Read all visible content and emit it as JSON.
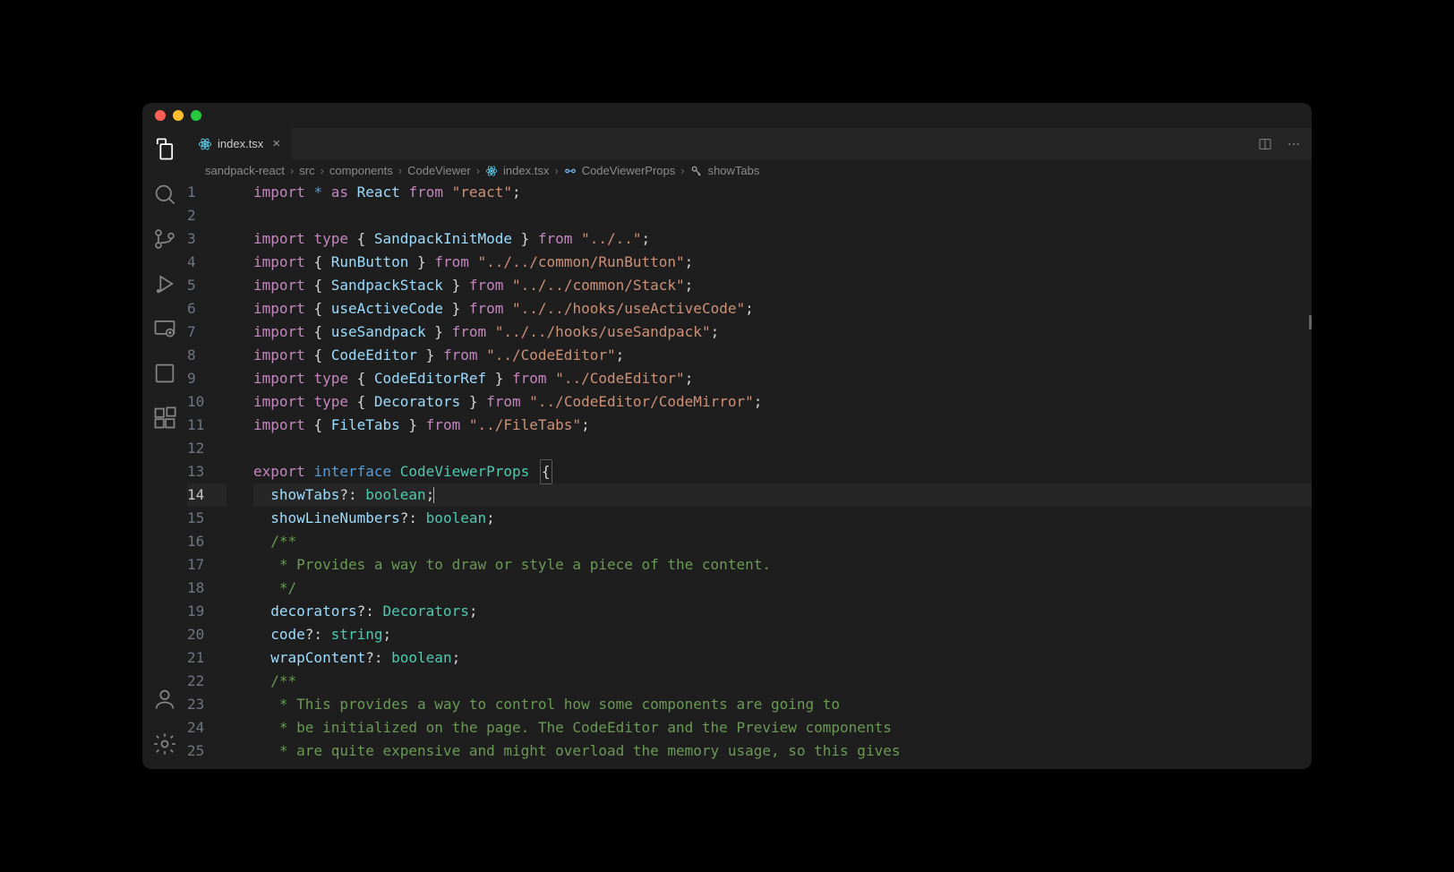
{
  "tab": {
    "filename": "index.tsx"
  },
  "breadcrumb": {
    "parts": [
      "sandpack-react",
      "src",
      "components",
      "CodeViewer",
      "index.tsx",
      "CodeViewerProps",
      "showTabs"
    ]
  },
  "activity": {
    "items": [
      "files",
      "search",
      "source-control",
      "run",
      "remote",
      "window",
      "extensions"
    ],
    "bottom": [
      "account",
      "settings"
    ]
  },
  "code": {
    "lines": [
      {
        "n": 1,
        "t": [
          [
            "kw",
            "import"
          ],
          [
            "op",
            " "
          ],
          [
            "star",
            "*"
          ],
          [
            "op",
            " "
          ],
          [
            "kw",
            "as"
          ],
          [
            "op",
            " "
          ],
          [
            "ident",
            "React"
          ],
          [
            "op",
            " "
          ],
          [
            "kw",
            "from"
          ],
          [
            "op",
            " "
          ],
          [
            "str",
            "\"react\""
          ],
          [
            "punct",
            ";"
          ]
        ]
      },
      {
        "n": 2,
        "t": []
      },
      {
        "n": 3,
        "t": [
          [
            "kw",
            "import"
          ],
          [
            "op",
            " "
          ],
          [
            "kw",
            "type"
          ],
          [
            "op",
            " "
          ],
          [
            "punct",
            "{ "
          ],
          [
            "ident",
            "SandpackInitMode"
          ],
          [
            "punct",
            " }"
          ],
          [
            "op",
            " "
          ],
          [
            "kw",
            "from"
          ],
          [
            "op",
            " "
          ],
          [
            "str",
            "\"../..\""
          ],
          [
            "punct",
            ";"
          ]
        ]
      },
      {
        "n": 4,
        "t": [
          [
            "kw",
            "import"
          ],
          [
            "op",
            " "
          ],
          [
            "punct",
            "{ "
          ],
          [
            "ident",
            "RunButton"
          ],
          [
            "punct",
            " }"
          ],
          [
            "op",
            " "
          ],
          [
            "kw",
            "from"
          ],
          [
            "op",
            " "
          ],
          [
            "str",
            "\"../../common/RunButton\""
          ],
          [
            "punct",
            ";"
          ]
        ]
      },
      {
        "n": 5,
        "t": [
          [
            "kw",
            "import"
          ],
          [
            "op",
            " "
          ],
          [
            "punct",
            "{ "
          ],
          [
            "ident",
            "SandpackStack"
          ],
          [
            "punct",
            " }"
          ],
          [
            "op",
            " "
          ],
          [
            "kw",
            "from"
          ],
          [
            "op",
            " "
          ],
          [
            "str",
            "\"../../common/Stack\""
          ],
          [
            "punct",
            ";"
          ]
        ]
      },
      {
        "n": 6,
        "t": [
          [
            "kw",
            "import"
          ],
          [
            "op",
            " "
          ],
          [
            "punct",
            "{ "
          ],
          [
            "ident",
            "useActiveCode"
          ],
          [
            "punct",
            " }"
          ],
          [
            "op",
            " "
          ],
          [
            "kw",
            "from"
          ],
          [
            "op",
            " "
          ],
          [
            "str",
            "\"../../hooks/useActiveCode\""
          ],
          [
            "punct",
            ";"
          ]
        ]
      },
      {
        "n": 7,
        "t": [
          [
            "kw",
            "import"
          ],
          [
            "op",
            " "
          ],
          [
            "punct",
            "{ "
          ],
          [
            "ident",
            "useSandpack"
          ],
          [
            "punct",
            " }"
          ],
          [
            "op",
            " "
          ],
          [
            "kw",
            "from"
          ],
          [
            "op",
            " "
          ],
          [
            "str",
            "\"../../hooks/useSandpack\""
          ],
          [
            "punct",
            ";"
          ]
        ]
      },
      {
        "n": 8,
        "t": [
          [
            "kw",
            "import"
          ],
          [
            "op",
            " "
          ],
          [
            "punct",
            "{ "
          ],
          [
            "ident",
            "CodeEditor"
          ],
          [
            "punct",
            " }"
          ],
          [
            "op",
            " "
          ],
          [
            "kw",
            "from"
          ],
          [
            "op",
            " "
          ],
          [
            "str",
            "\"../CodeEditor\""
          ],
          [
            "punct",
            ";"
          ]
        ]
      },
      {
        "n": 9,
        "t": [
          [
            "kw",
            "import"
          ],
          [
            "op",
            " "
          ],
          [
            "kw",
            "type"
          ],
          [
            "op",
            " "
          ],
          [
            "punct",
            "{ "
          ],
          [
            "ident",
            "CodeEditorRef"
          ],
          [
            "punct",
            " }"
          ],
          [
            "op",
            " "
          ],
          [
            "kw",
            "from"
          ],
          [
            "op",
            " "
          ],
          [
            "str",
            "\"../CodeEditor\""
          ],
          [
            "punct",
            ";"
          ]
        ]
      },
      {
        "n": 10,
        "t": [
          [
            "kw",
            "import"
          ],
          [
            "op",
            " "
          ],
          [
            "kw",
            "type"
          ],
          [
            "op",
            " "
          ],
          [
            "punct",
            "{ "
          ],
          [
            "ident",
            "Decorators"
          ],
          [
            "punct",
            " }"
          ],
          [
            "op",
            " "
          ],
          [
            "kw",
            "from"
          ],
          [
            "op",
            " "
          ],
          [
            "str",
            "\"../CodeEditor/CodeMirror\""
          ],
          [
            "punct",
            ";"
          ]
        ]
      },
      {
        "n": 11,
        "t": [
          [
            "kw",
            "import"
          ],
          [
            "op",
            " "
          ],
          [
            "punct",
            "{ "
          ],
          [
            "ident",
            "FileTabs"
          ],
          [
            "punct",
            " }"
          ],
          [
            "op",
            " "
          ],
          [
            "kw",
            "from"
          ],
          [
            "op",
            " "
          ],
          [
            "str",
            "\"../FileTabs\""
          ],
          [
            "punct",
            ";"
          ]
        ]
      },
      {
        "n": 12,
        "t": []
      },
      {
        "n": 13,
        "t": [
          [
            "kw",
            "export"
          ],
          [
            "op",
            " "
          ],
          [
            "type",
            "interface"
          ],
          [
            "op",
            " "
          ],
          [
            "iface",
            "CodeViewerProps"
          ],
          [
            "op",
            " "
          ],
          [
            "boxed",
            "{"
          ]
        ]
      },
      {
        "n": 14,
        "active": true,
        "t": [
          [
            "op",
            "  "
          ],
          [
            "prop",
            "showTabs"
          ],
          [
            "punct",
            "?:"
          ],
          [
            "op",
            " "
          ],
          [
            "iface",
            "boolean"
          ],
          [
            "punct",
            ";"
          ],
          [
            "cursor",
            ""
          ]
        ]
      },
      {
        "n": 15,
        "t": [
          [
            "op",
            "  "
          ],
          [
            "prop",
            "showLineNumbers"
          ],
          [
            "punct",
            "?:"
          ],
          [
            "op",
            " "
          ],
          [
            "iface",
            "boolean"
          ],
          [
            "punct",
            ";"
          ]
        ]
      },
      {
        "n": 16,
        "t": [
          [
            "op",
            "  "
          ],
          [
            "comment",
            "/**"
          ]
        ]
      },
      {
        "n": 17,
        "t": [
          [
            "op",
            "   "
          ],
          [
            "comment",
            "* Provides a way to draw or style a piece of the content."
          ]
        ]
      },
      {
        "n": 18,
        "t": [
          [
            "op",
            "   "
          ],
          [
            "comment",
            "*/"
          ]
        ]
      },
      {
        "n": 19,
        "t": [
          [
            "op",
            "  "
          ],
          [
            "prop",
            "decorators"
          ],
          [
            "punct",
            "?:"
          ],
          [
            "op",
            " "
          ],
          [
            "iface",
            "Decorators"
          ],
          [
            "punct",
            ";"
          ]
        ]
      },
      {
        "n": 20,
        "t": [
          [
            "op",
            "  "
          ],
          [
            "prop",
            "code"
          ],
          [
            "punct",
            "?:"
          ],
          [
            "op",
            " "
          ],
          [
            "iface",
            "string"
          ],
          [
            "punct",
            ";"
          ]
        ]
      },
      {
        "n": 21,
        "t": [
          [
            "op",
            "  "
          ],
          [
            "prop",
            "wrapContent"
          ],
          [
            "punct",
            "?:"
          ],
          [
            "op",
            " "
          ],
          [
            "iface",
            "boolean"
          ],
          [
            "punct",
            ";"
          ]
        ]
      },
      {
        "n": 22,
        "t": [
          [
            "op",
            "  "
          ],
          [
            "comment",
            "/**"
          ]
        ]
      },
      {
        "n": 23,
        "t": [
          [
            "op",
            "   "
          ],
          [
            "comment",
            "* This provides a way to control how some components are going to"
          ]
        ]
      },
      {
        "n": 24,
        "t": [
          [
            "op",
            "   "
          ],
          [
            "comment",
            "* be initialized on the page. The CodeEditor and the Preview components"
          ]
        ]
      },
      {
        "n": 25,
        "t": [
          [
            "op",
            "   "
          ],
          [
            "comment",
            "* are quite expensive and might overload the memory usage, so this gives"
          ]
        ]
      }
    ]
  }
}
